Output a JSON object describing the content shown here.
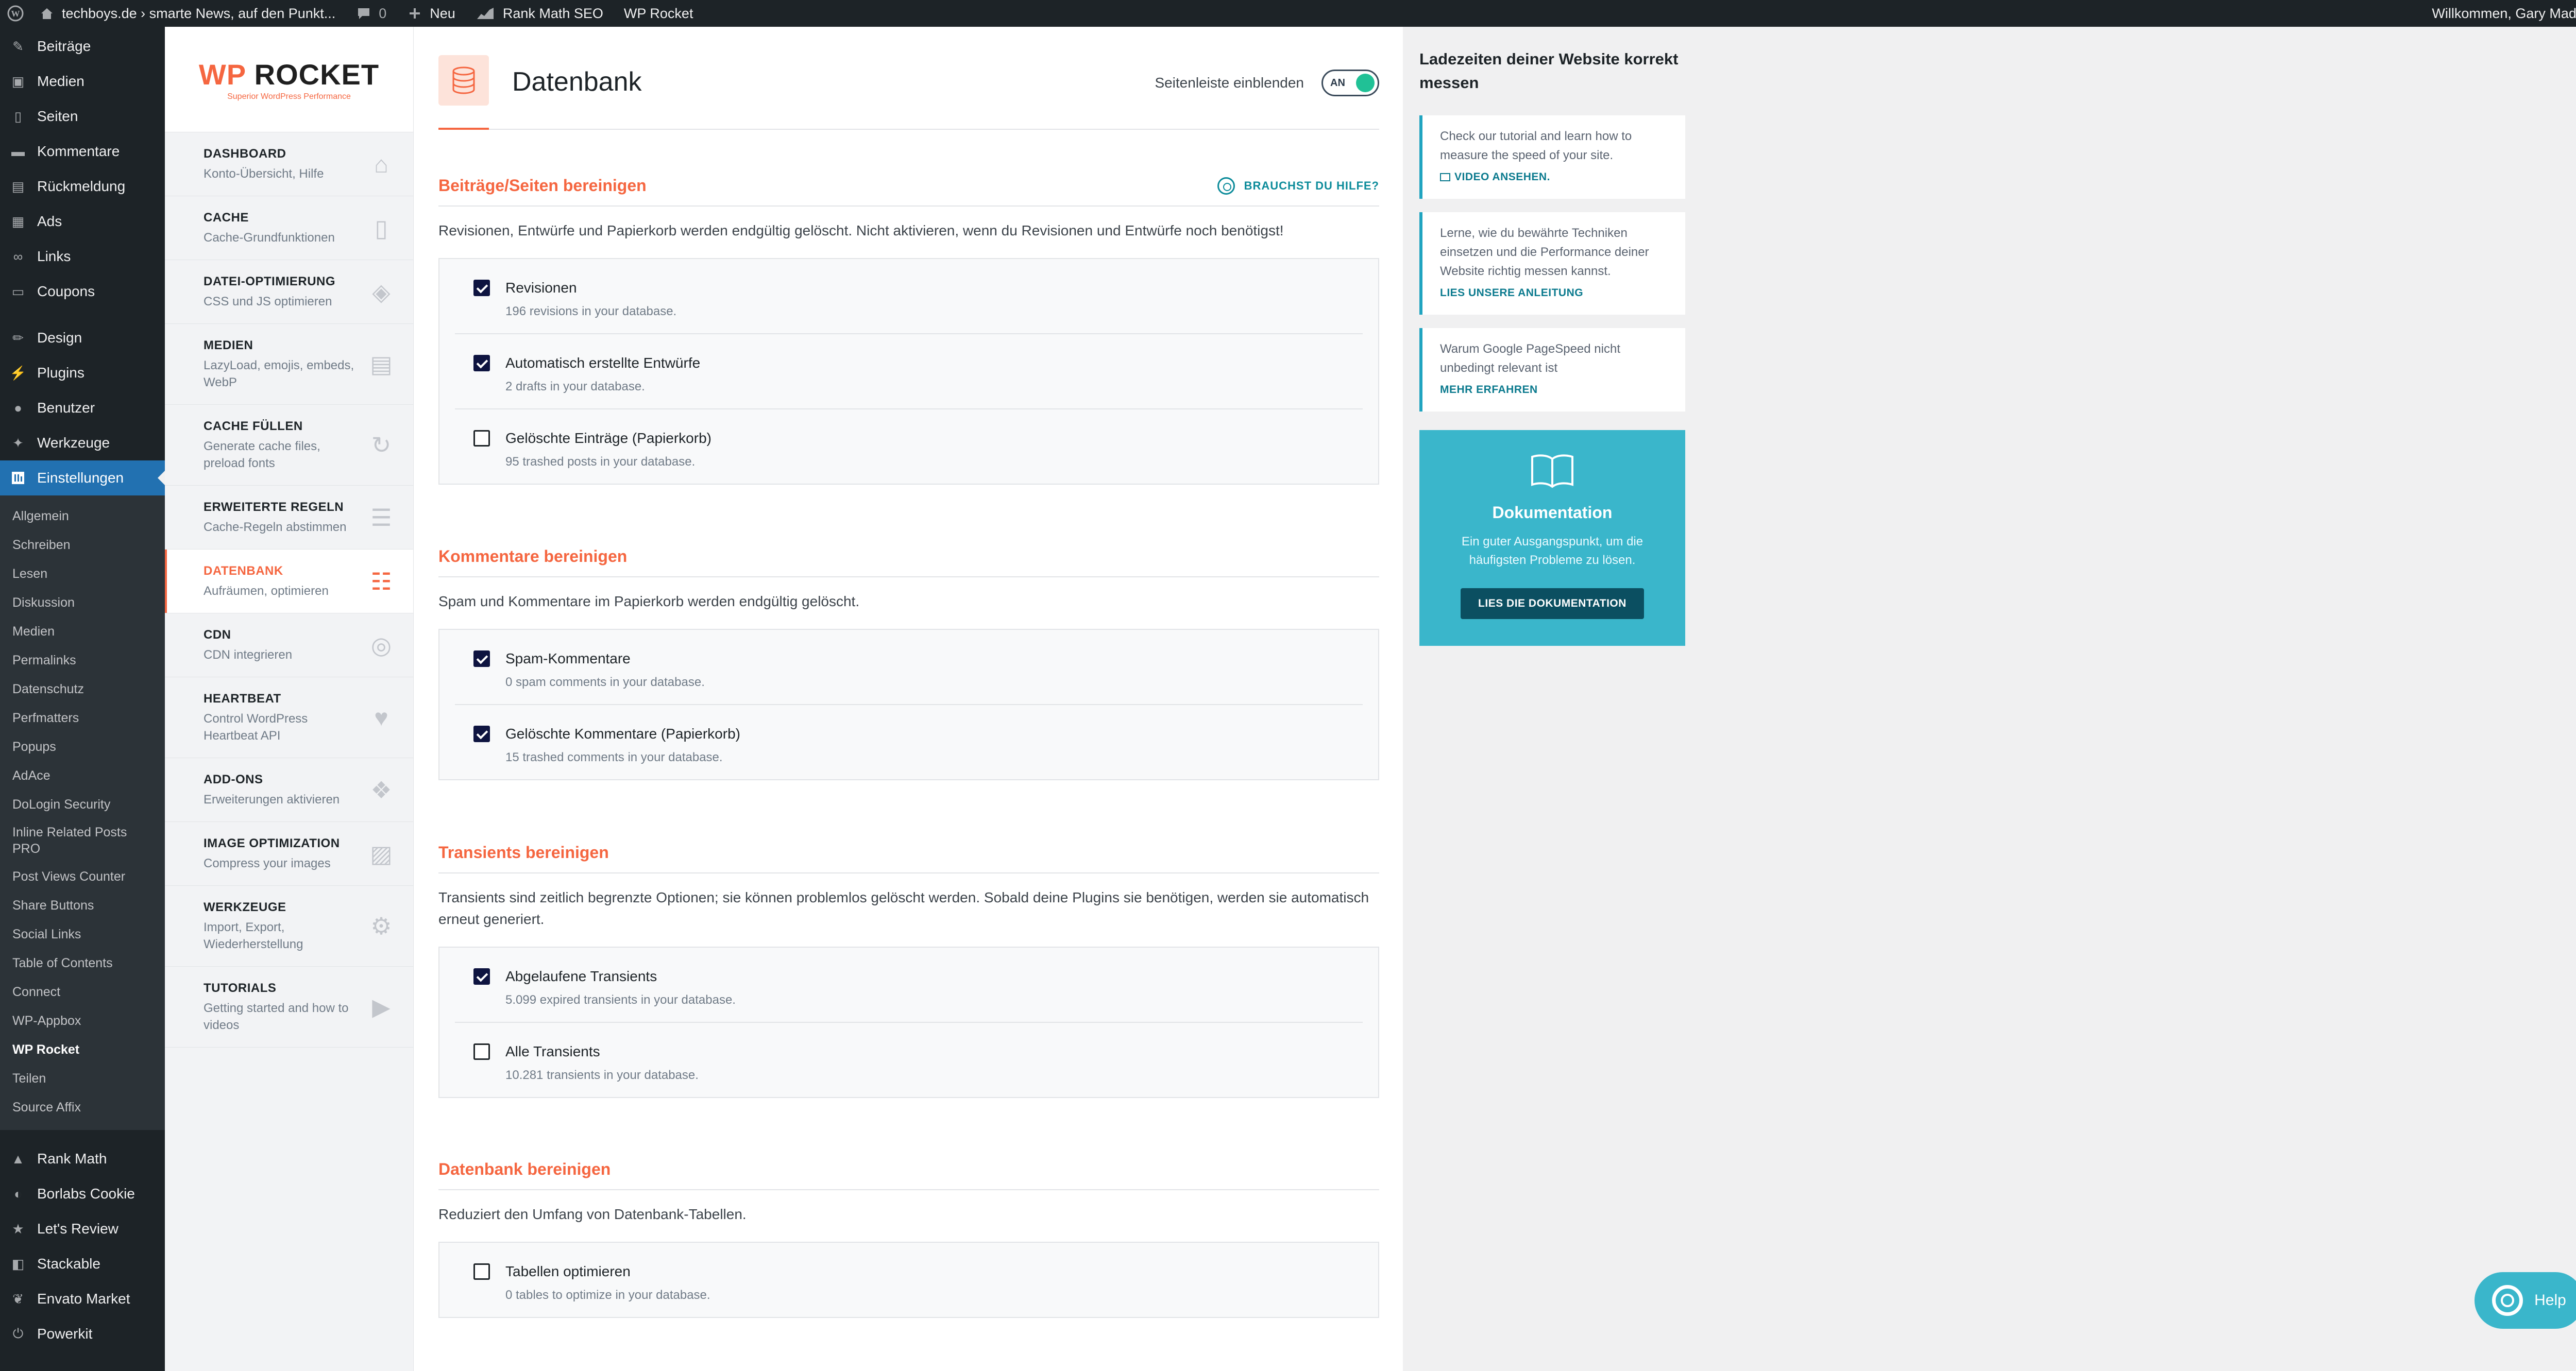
{
  "adminbar": {
    "site_title": "techboys.de › smarte News, auf den Punkt...",
    "comments_count": "0",
    "new_label": "Neu",
    "rankmath_label": "Rank Math SEO",
    "wprocket_label": "WP Rocket",
    "greeting": "Willkommen, Gary Madeo"
  },
  "admin_menu": {
    "items_top": [
      {
        "label": "Beiträge",
        "icon": "pin-icon"
      },
      {
        "label": "Medien",
        "icon": "media-icon"
      },
      {
        "label": "Seiten",
        "icon": "page-icon"
      },
      {
        "label": "Kommentare",
        "icon": "comment-icon"
      },
      {
        "label": "Rückmeldung",
        "icon": "feedback-icon"
      },
      {
        "label": "Ads",
        "icon": "ads-icon"
      },
      {
        "label": "Links",
        "icon": "links-icon"
      },
      {
        "label": "Coupons",
        "icon": "coupon-icon"
      }
    ],
    "items_mid": [
      {
        "label": "Design",
        "icon": "brush-icon"
      },
      {
        "label": "Plugins",
        "icon": "plugin-icon"
      },
      {
        "label": "Benutzer",
        "icon": "user-icon"
      },
      {
        "label": "Werkzeuge",
        "icon": "wrench-icon"
      }
    ],
    "current": {
      "label": "Einstellungen",
      "icon": "settings-icon"
    },
    "submenu": [
      "Allgemein",
      "Schreiben",
      "Lesen",
      "Diskussion",
      "Medien",
      "Permalinks",
      "Datenschutz",
      "Perfmatters",
      "Popups",
      "AdAce",
      "DoLogin Security",
      "Inline Related Posts PRO",
      "Post Views Counter",
      "Share Buttons",
      "Social Links",
      "Table of Contents",
      "Connect",
      "WP-Appbox",
      "WP Rocket",
      "Teilen",
      "Source Affix"
    ],
    "submenu_active": "WP Rocket",
    "items_bottom": [
      {
        "label": "Rank Math",
        "icon": "chart-icon"
      },
      {
        "label": "Borlabs Cookie",
        "icon": "cookie-icon"
      },
      {
        "label": "Let's Review",
        "icon": "star-icon"
      },
      {
        "label": "Stackable",
        "icon": "stack-icon"
      },
      {
        "label": "Envato Market",
        "icon": "leaf-icon"
      },
      {
        "label": "Powerkit",
        "icon": "power-icon"
      }
    ]
  },
  "rocket": {
    "logo_wp": "WP",
    "logo_rocket": "ROCKET",
    "tagline": "Superior WordPress Performance",
    "nav": [
      {
        "title": "DASHBOARD",
        "sub": "Konto-Übersicht, Hilfe",
        "icon": "home-icon",
        "glyph": "⌂"
      },
      {
        "title": "CACHE",
        "sub": "Cache-Grundfunktionen",
        "icon": "file-icon",
        "glyph": "▯"
      },
      {
        "title": "DATEI-OPTIMIERUNG",
        "sub": "CSS und JS optimieren",
        "icon": "layers-icon",
        "glyph": "◈"
      },
      {
        "title": "MEDIEN",
        "sub": "LazyLoad, emojis, embeds, WebP",
        "icon": "images-icon",
        "glyph": "▤"
      },
      {
        "title": "CACHE FÜLLEN",
        "sub": "Generate cache files, preload fonts",
        "icon": "refresh-icon",
        "glyph": "↻"
      },
      {
        "title": "ERWEITERTE REGELN",
        "sub": "Cache-Regeln abstimmen",
        "icon": "list-icon",
        "glyph": "☰"
      },
      {
        "title": "DATENBANK",
        "sub": "Aufräumen, optimieren",
        "icon": "database-icon",
        "glyph": "☷"
      },
      {
        "title": "CDN",
        "sub": "CDN integrieren",
        "icon": "cdn-icon",
        "glyph": "◎"
      },
      {
        "title": "HEARTBEAT",
        "sub": "Control WordPress Heartbeat API",
        "icon": "heart-icon",
        "glyph": "♥"
      },
      {
        "title": "ADD-ONS",
        "sub": "Erweiterungen aktivieren",
        "icon": "addons-icon",
        "glyph": "❖"
      },
      {
        "title": "IMAGE OPTIMIZATION",
        "sub": "Compress your images",
        "icon": "image-icon",
        "glyph": "▨"
      },
      {
        "title": "WERKZEUGE",
        "sub": "Import, Export, Wiederherstellung",
        "icon": "tools-icon",
        "glyph": "⚙"
      },
      {
        "title": "TUTORIALS",
        "sub": "Getting started and how to videos",
        "icon": "video-icon",
        "glyph": "▶"
      }
    ],
    "active_index": 6
  },
  "main": {
    "page_title": "Datenbank",
    "sidebar_toggle_label": "Seitenleiste einblenden",
    "toggle_state": "AN",
    "help_label": "BRAUCHST DU HILFE?",
    "sections": [
      {
        "title": "Beiträge/Seiten bereinigen",
        "desc": "Revisionen, Entwürfe und Papierkorb werden endgültig gelöscht. Nicht aktivieren, wenn du Revisionen und Entwürfe noch benötigst!",
        "options": [
          {
            "label": "Revisionen",
            "sub": "196 revisions in your database.",
            "checked": true
          },
          {
            "label": "Automatisch erstellte Entwürfe",
            "sub": "2 drafts in your database.",
            "checked": true
          },
          {
            "label": "Gelöschte Einträge (Papierkorb)",
            "sub": "95 trashed posts in your database.",
            "checked": false
          }
        ]
      },
      {
        "title": "Kommentare bereinigen",
        "desc": "Spam und Kommentare im Papierkorb werden endgültig gelöscht.",
        "options": [
          {
            "label": "Spam-Kommentare",
            "sub": "0 spam comments in your database.",
            "checked": true
          },
          {
            "label": "Gelöschte Kommentare (Papierkorb)",
            "sub": "15 trashed comments in your database.",
            "checked": true
          }
        ]
      },
      {
        "title": "Transients bereinigen",
        "desc": "Transients sind zeitlich begrenzte Optionen; sie können problemlos gelöscht werden. Sobald deine Plugins sie benötigen, werden sie automatisch erneut generiert.",
        "options": [
          {
            "label": "Abgelaufene Transients",
            "sub": "5.099 expired transients in your database.",
            "checked": true
          },
          {
            "label": "Alle Transients",
            "sub": "10.281 transients in your database.",
            "checked": false
          }
        ]
      },
      {
        "title": "Datenbank bereinigen",
        "desc": "Reduziert den Umfang von Datenbank-Tabellen.",
        "options": [
          {
            "label": "Tabellen optimieren",
            "sub": "0 tables to optimize in your database.",
            "checked": false
          }
        ]
      }
    ]
  },
  "sidebar": {
    "heading": "Ladezeiten deiner Website korrekt messen",
    "tips": [
      {
        "text": "Check our tutorial and learn how to measure the speed of your site.",
        "link": "VIDEO ANSEHEN."
      },
      {
        "text": "Lerne, wie du bewährte Techniken einsetzen und die Performance deiner Website richtig messen kannst.",
        "link": "LIES UNSERE ANLEITUNG"
      },
      {
        "text": "Warum Google PageSpeed nicht unbedingt relevant ist",
        "link": "MEHR ERFAHREN"
      }
    ],
    "docs": {
      "title": "Dokumentation",
      "desc": "Ein guter Ausgangspunkt, um die häufigsten Probleme zu lösen.",
      "button": "LIES DIE DOKUMENTATION"
    }
  },
  "help_button": "Help",
  "colors": {
    "accent": "#f56640",
    "teal": "#3ab6cb",
    "wp_dark": "#1d2327",
    "wp_blue": "#2271b1"
  }
}
